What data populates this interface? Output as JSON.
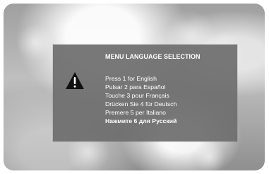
{
  "screen": {
    "title": "MENU LANGUAGE SELECTION",
    "warning_icon": "warning-icon"
  },
  "languages": [
    {
      "label": "Press 1 for English"
    },
    {
      "label": "Pulsar 2 para Español"
    },
    {
      "label": "Touche 3 pour Français"
    },
    {
      "label": "Drücken Sie 4 für Deutsch"
    },
    {
      "label": "Premere 5 per Italiano"
    },
    {
      "label": "Нажмите 6 для Русский"
    }
  ]
}
